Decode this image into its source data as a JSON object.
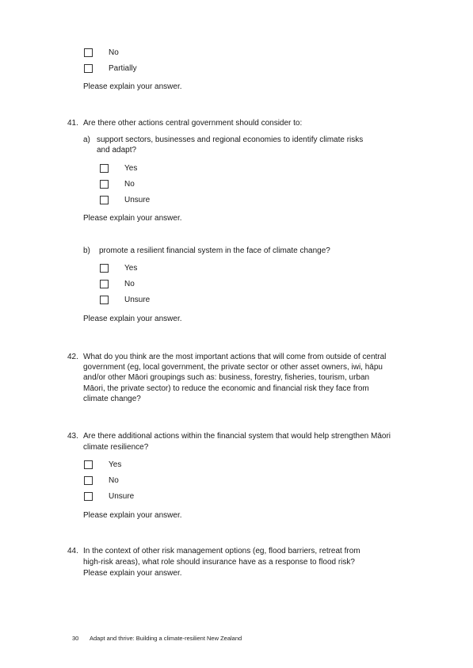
{
  "carryover": {
    "options": [
      "No",
      "Partially"
    ],
    "explain": "Please explain your answer."
  },
  "q41": {
    "number": "41.",
    "text": "Are there other actions central government should consider to:",
    "a": {
      "label": "a)",
      "line1": "support sectors, businesses and regional economies to identify climate risks",
      "line2": "and adapt?",
      "options": [
        "Yes",
        "No",
        "Unsure"
      ],
      "explain": "Please explain your answer."
    },
    "b": {
      "label": "b)",
      "text": "promote a resilient financial system in the face of climate change?",
      "options": [
        "Yes",
        "No",
        "Unsure"
      ],
      "explain": "Please explain your answer."
    }
  },
  "q42": {
    "number": "42.",
    "lines": [
      "What do you think are the most important actions that will come from outside of central",
      "government (eg, local government, the private sector or other asset owners, iwi, hāpu",
      "and/or other Māori groupings such as: business, forestry, fisheries, tourism, urban",
      "Māori, the private sector) to reduce the economic and financial risk they face from",
      "climate change?"
    ]
  },
  "q43": {
    "number": "43.",
    "lines": [
      "Are there additional actions within the financial system that would help strengthen Māori",
      "climate resilience?"
    ],
    "options": [
      "Yes",
      "No",
      "Unsure"
    ],
    "explain": "Please explain your answer."
  },
  "q44": {
    "number": "44.",
    "lines": [
      "In the context of other risk management options (eg, flood barriers, retreat from",
      "high-risk areas), what role should insurance have as a response to flood risk?",
      "Please explain your answer."
    ]
  },
  "footer": {
    "page_number": "30",
    "title": "Adapt and thrive: Building a climate-resilient New Zealand"
  }
}
